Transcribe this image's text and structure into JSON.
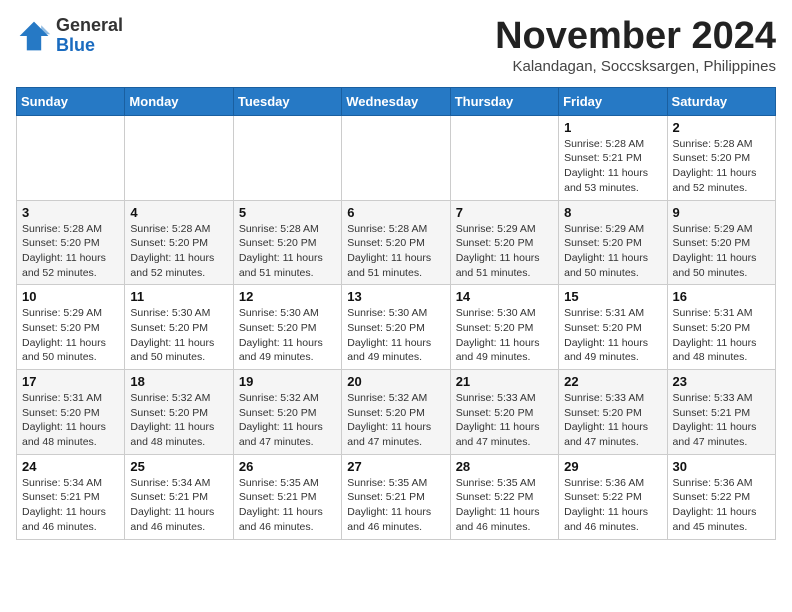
{
  "logo": {
    "general": "General",
    "blue": "Blue"
  },
  "title": "November 2024",
  "subtitle": "Kalandagan, Soccsksargen, Philippines",
  "weekdays": [
    "Sunday",
    "Monday",
    "Tuesday",
    "Wednesday",
    "Thursday",
    "Friday",
    "Saturday"
  ],
  "weeks": [
    [
      {
        "day": "",
        "info": ""
      },
      {
        "day": "",
        "info": ""
      },
      {
        "day": "",
        "info": ""
      },
      {
        "day": "",
        "info": ""
      },
      {
        "day": "",
        "info": ""
      },
      {
        "day": "1",
        "info": "Sunrise: 5:28 AM\nSunset: 5:21 PM\nDaylight: 11 hours and 53 minutes."
      },
      {
        "day": "2",
        "info": "Sunrise: 5:28 AM\nSunset: 5:20 PM\nDaylight: 11 hours and 52 minutes."
      }
    ],
    [
      {
        "day": "3",
        "info": "Sunrise: 5:28 AM\nSunset: 5:20 PM\nDaylight: 11 hours and 52 minutes."
      },
      {
        "day": "4",
        "info": "Sunrise: 5:28 AM\nSunset: 5:20 PM\nDaylight: 11 hours and 52 minutes."
      },
      {
        "day": "5",
        "info": "Sunrise: 5:28 AM\nSunset: 5:20 PM\nDaylight: 11 hours and 51 minutes."
      },
      {
        "day": "6",
        "info": "Sunrise: 5:28 AM\nSunset: 5:20 PM\nDaylight: 11 hours and 51 minutes."
      },
      {
        "day": "7",
        "info": "Sunrise: 5:29 AM\nSunset: 5:20 PM\nDaylight: 11 hours and 51 minutes."
      },
      {
        "day": "8",
        "info": "Sunrise: 5:29 AM\nSunset: 5:20 PM\nDaylight: 11 hours and 50 minutes."
      },
      {
        "day": "9",
        "info": "Sunrise: 5:29 AM\nSunset: 5:20 PM\nDaylight: 11 hours and 50 minutes."
      }
    ],
    [
      {
        "day": "10",
        "info": "Sunrise: 5:29 AM\nSunset: 5:20 PM\nDaylight: 11 hours and 50 minutes."
      },
      {
        "day": "11",
        "info": "Sunrise: 5:30 AM\nSunset: 5:20 PM\nDaylight: 11 hours and 50 minutes."
      },
      {
        "day": "12",
        "info": "Sunrise: 5:30 AM\nSunset: 5:20 PM\nDaylight: 11 hours and 49 minutes."
      },
      {
        "day": "13",
        "info": "Sunrise: 5:30 AM\nSunset: 5:20 PM\nDaylight: 11 hours and 49 minutes."
      },
      {
        "day": "14",
        "info": "Sunrise: 5:30 AM\nSunset: 5:20 PM\nDaylight: 11 hours and 49 minutes."
      },
      {
        "day": "15",
        "info": "Sunrise: 5:31 AM\nSunset: 5:20 PM\nDaylight: 11 hours and 49 minutes."
      },
      {
        "day": "16",
        "info": "Sunrise: 5:31 AM\nSunset: 5:20 PM\nDaylight: 11 hours and 48 minutes."
      }
    ],
    [
      {
        "day": "17",
        "info": "Sunrise: 5:31 AM\nSunset: 5:20 PM\nDaylight: 11 hours and 48 minutes."
      },
      {
        "day": "18",
        "info": "Sunrise: 5:32 AM\nSunset: 5:20 PM\nDaylight: 11 hours and 48 minutes."
      },
      {
        "day": "19",
        "info": "Sunrise: 5:32 AM\nSunset: 5:20 PM\nDaylight: 11 hours and 47 minutes."
      },
      {
        "day": "20",
        "info": "Sunrise: 5:32 AM\nSunset: 5:20 PM\nDaylight: 11 hours and 47 minutes."
      },
      {
        "day": "21",
        "info": "Sunrise: 5:33 AM\nSunset: 5:20 PM\nDaylight: 11 hours and 47 minutes."
      },
      {
        "day": "22",
        "info": "Sunrise: 5:33 AM\nSunset: 5:20 PM\nDaylight: 11 hours and 47 minutes."
      },
      {
        "day": "23",
        "info": "Sunrise: 5:33 AM\nSunset: 5:21 PM\nDaylight: 11 hours and 47 minutes."
      }
    ],
    [
      {
        "day": "24",
        "info": "Sunrise: 5:34 AM\nSunset: 5:21 PM\nDaylight: 11 hours and 46 minutes."
      },
      {
        "day": "25",
        "info": "Sunrise: 5:34 AM\nSunset: 5:21 PM\nDaylight: 11 hours and 46 minutes."
      },
      {
        "day": "26",
        "info": "Sunrise: 5:35 AM\nSunset: 5:21 PM\nDaylight: 11 hours and 46 minutes."
      },
      {
        "day": "27",
        "info": "Sunrise: 5:35 AM\nSunset: 5:21 PM\nDaylight: 11 hours and 46 minutes."
      },
      {
        "day": "28",
        "info": "Sunrise: 5:35 AM\nSunset: 5:22 PM\nDaylight: 11 hours and 46 minutes."
      },
      {
        "day": "29",
        "info": "Sunrise: 5:36 AM\nSunset: 5:22 PM\nDaylight: 11 hours and 46 minutes."
      },
      {
        "day": "30",
        "info": "Sunrise: 5:36 AM\nSunset: 5:22 PM\nDaylight: 11 hours and 45 minutes."
      }
    ]
  ]
}
